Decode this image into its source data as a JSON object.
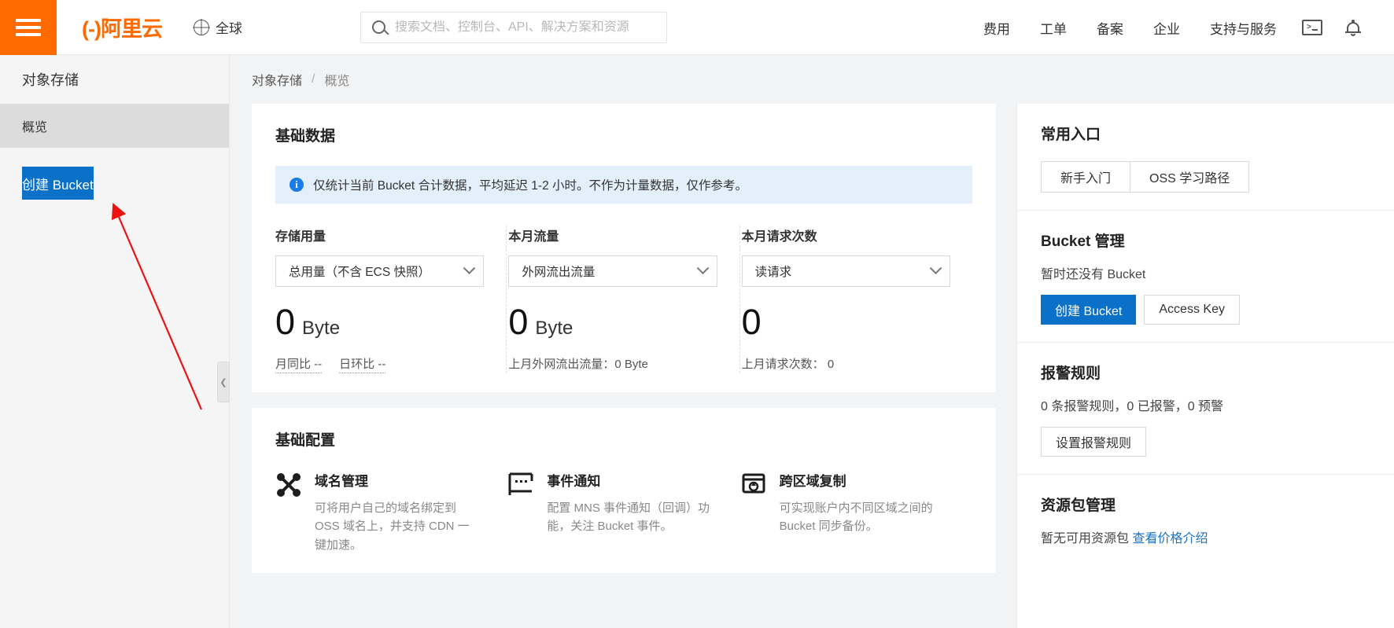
{
  "header": {
    "menu_icon": "hamburger-menu-icon",
    "logo_text": "(-)阿里云",
    "region_label": "全球",
    "region_icon": "globe-icon",
    "search": {
      "placeholder": "搜索文档、控制台、API、解决方案和资源",
      "value": "",
      "icon": "search-icon"
    },
    "nav_items": [
      {
        "label": "费用"
      },
      {
        "label": "工单"
      },
      {
        "label": "备案"
      },
      {
        "label": "企业"
      },
      {
        "label": "支持与服务"
      }
    ],
    "icons": [
      {
        "name": "terminal-console-icon"
      },
      {
        "name": "notification-bell-icon"
      }
    ]
  },
  "sidebar": {
    "title": "对象存储",
    "items": [
      {
        "label": "概览",
        "active": true
      }
    ],
    "create_bucket_label": "创建 Bucket",
    "collapse_icon": "chevron-left-icon"
  },
  "breadcrumb": {
    "items": [
      "对象存储",
      "概览"
    ],
    "separator": "/"
  },
  "basic_data": {
    "title": "基础数据",
    "alert": {
      "icon": "info-icon",
      "text": "仅统计当前 Bucket 合计数据，平均延迟 1-2 小时。不作为计量数据，仅作参考。"
    },
    "stats": [
      {
        "label": "存储用量",
        "select_value": "总用量（不含 ECS 快照）",
        "value": "0",
        "unit": "Byte",
        "footnotes": [
          "月同比 --",
          "日环比 --"
        ]
      },
      {
        "label": "本月流量",
        "select_value": "外网流出流量",
        "value": "0",
        "unit": "Byte",
        "footnotes": [
          "上月外网流出流量：0 Byte"
        ]
      },
      {
        "label": "本月请求次数",
        "select_value": "读请求",
        "value": "0",
        "unit": "",
        "footnotes": [
          "上月请求次数： 0"
        ]
      }
    ]
  },
  "basic_config": {
    "title": "基础配置",
    "features": [
      {
        "icon": "domain-nodes-icon",
        "title": "域名管理",
        "desc": "可将用户自己的域名绑定到 OSS 域名上，并支持 CDN 一键加速。"
      },
      {
        "icon": "event-notification-icon",
        "title": "事件通知",
        "desc": "配置 MNS 事件通知（回调）功能，关注 Bucket 事件。"
      },
      {
        "icon": "cross-region-replication-icon",
        "title": "跨区域复制",
        "desc": "可实现账户内不同区域之间的 Bucket 同步备份。"
      }
    ]
  },
  "right_panel": {
    "common_entries": {
      "title": "常用入口",
      "buttons": [
        "新手入门",
        "OSS 学习路径"
      ]
    },
    "bucket_manage": {
      "title": "Bucket 管理",
      "text": "暂时还没有 Bucket",
      "primary_button": "创建 Bucket",
      "secondary_button": "Access Key"
    },
    "alarm_rules": {
      "title": "报警规则",
      "text": "0 条报警规则，0 已报警，0 预警",
      "button": "设置报警规则"
    },
    "resource_package": {
      "title": "资源包管理",
      "text": "暂无可用资源包",
      "link": "查看价格介绍"
    }
  },
  "annotation": {
    "arrow_color": "#ee1111"
  }
}
